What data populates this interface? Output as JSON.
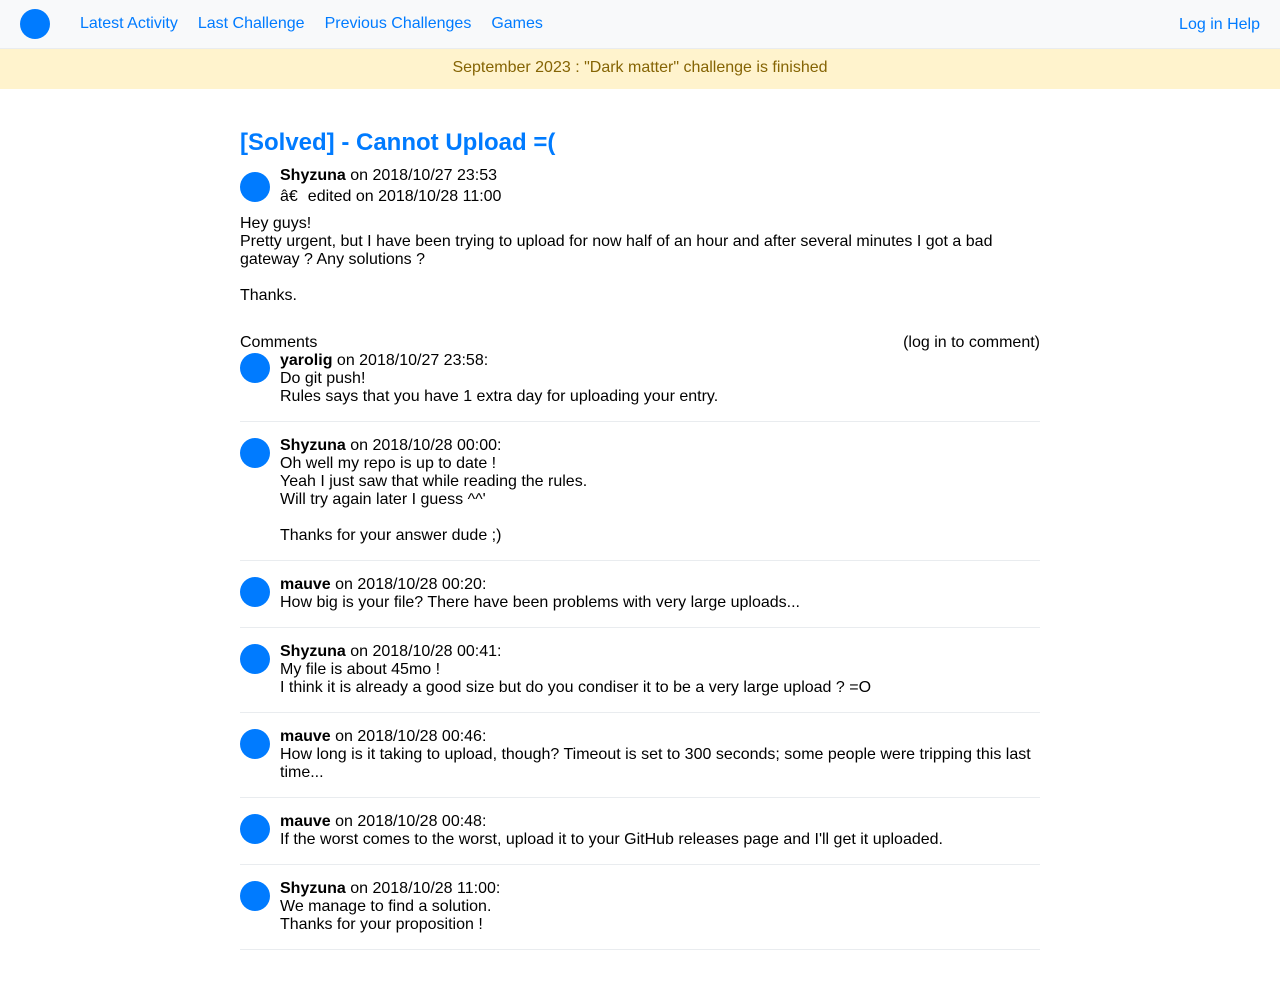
{
  "nav": {
    "links": [
      {
        "label": "Latest Activity"
      },
      {
        "label": "Last Challenge"
      },
      {
        "label": "Previous Challenges"
      },
      {
        "label": "Games"
      }
    ],
    "login": "Log in",
    "help": "Help"
  },
  "banner": {
    "text": "September 2023 : \"Dark matter\" challenge is finished"
  },
  "post": {
    "title": "[Solved] - Cannot Upload =(",
    "author": "Shyzuna",
    "posted": " on 2018/10/27 23:53",
    "edited_mark": "â€",
    "edited": "edited on 2018/10/28 11:00",
    "paragraphs": [
      [
        "Hey guys!",
        "Pretty urgent, but I have been trying to upload for now half of an hour and after several minutes I got a bad gateway ? Any solutions ?"
      ],
      [
        "Thanks."
      ]
    ]
  },
  "comments": {
    "label": "Comments",
    "login_prompt": "(log in to comment)",
    "items": [
      {
        "author": "yarolig",
        "date": " on 2018/10/27 23:58:",
        "paragraphs": [
          [
            "Do git push!",
            "Rules says that you have 1 extra day for uploading your entry."
          ]
        ]
      },
      {
        "author": "Shyzuna",
        "date": " on 2018/10/28 00:00:",
        "paragraphs": [
          [
            "Oh well my repo is up to date !",
            "Yeah I just saw that while reading the rules.",
            "Will try again later I guess ^^'"
          ],
          [
            "Thanks for your answer dude ;)"
          ]
        ]
      },
      {
        "author": "mauve",
        "date": " on 2018/10/28 00:20:",
        "paragraphs": [
          [
            "How big is your file? There have been problems with very large uploads..."
          ]
        ]
      },
      {
        "author": "Shyzuna",
        "date": " on 2018/10/28 00:41:",
        "paragraphs": [
          [
            "My file is about 45mo !",
            "I think it is already a good size but do you condiser it to be a very large upload ? =O"
          ]
        ]
      },
      {
        "author": "mauve",
        "date": " on 2018/10/28 00:46:",
        "paragraphs": [
          [
            "How long is it taking to upload, though? Timeout is set to 300 seconds; some people were tripping this last time..."
          ]
        ]
      },
      {
        "author": "mauve",
        "date": " on 2018/10/28 00:48:",
        "paragraphs": [
          [
            "If the worst comes to the worst, upload it to your GitHub releases page and I'll get it uploaded."
          ]
        ]
      },
      {
        "author": "Shyzuna",
        "date": " on 2018/10/28 11:00:",
        "paragraphs": [
          [
            "We manage to find a solution.",
            "Thanks for your proposition !"
          ]
        ]
      }
    ]
  },
  "colors": {
    "accent": "#007bff",
    "banner_bg": "#fff3cd",
    "banner_text": "#856404",
    "navbar_bg": "#f8f9fa"
  }
}
